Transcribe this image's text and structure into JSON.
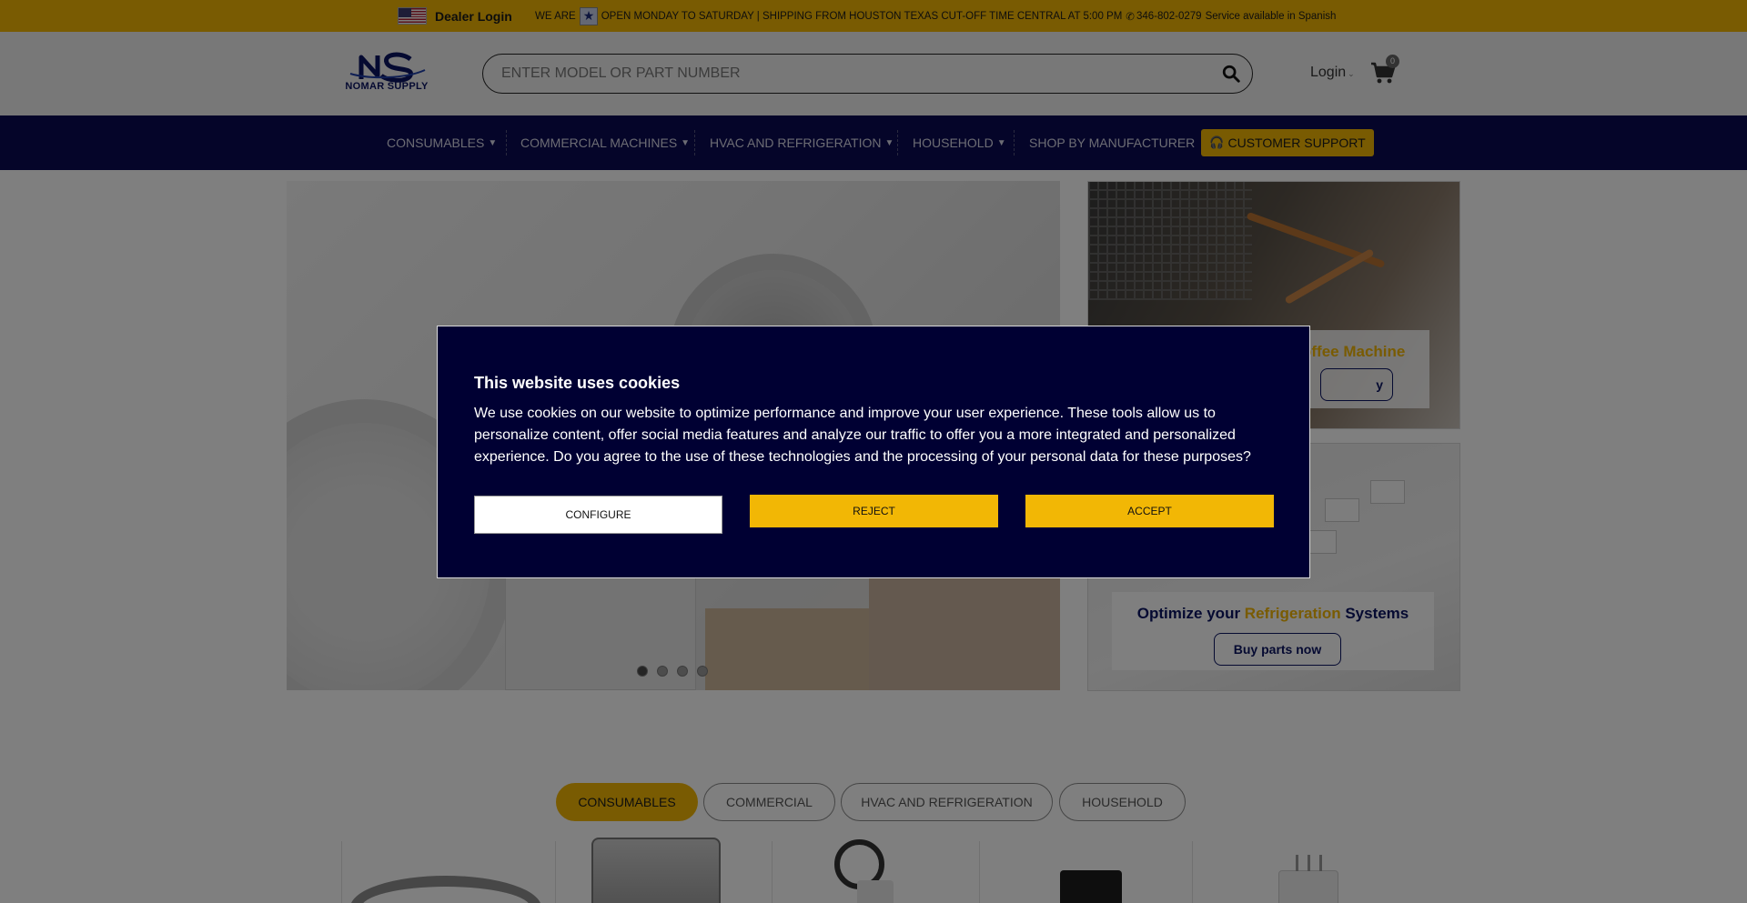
{
  "topbar": {
    "dealer_login": "Dealer Login",
    "we_are": "WE ARE",
    "hours": "OPEN MONDAY TO SATURDAY | SHIPPING FROM HOUSTON TEXAS  CUT-OFF TIME CENTRAL AT 5:00 PM",
    "phone": "346-802-0279",
    "spanish": "Service available in Spanish"
  },
  "header": {
    "logo_initials": "NS",
    "logo_text": "NOMAR SUPPLY",
    "search_placeholder": "ENTER MODEL OR PART NUMBER",
    "login_label": "Login",
    "cart_count": "0"
  },
  "nav": {
    "items": [
      {
        "label": "CONSUMABLES"
      },
      {
        "label": "COMMERCIAL MACHINES"
      },
      {
        "label": "HVAC AND REFRIGERATION"
      },
      {
        "label": "HOUSEHOLD"
      },
      {
        "label": "SHOP BY MANUFACTURER"
      }
    ],
    "support_label": "CUSTOMER SUPPORT"
  },
  "banners": {
    "top": {
      "title_fragment": "offee Machine",
      "button_fragment": "y"
    },
    "bottom": {
      "title_prefix": "Optimize your ",
      "title_accent": "Refrigeration",
      "title_suffix": " Systems",
      "button": "Buy parts now"
    }
  },
  "carousel": {
    "slide_count": 4,
    "active_index": 0
  },
  "tabs": [
    {
      "label": "CONSUMABLES",
      "active": true
    },
    {
      "label": "COMMERCIAL",
      "active": false
    },
    {
      "label": "HVAC AND REFRIGERATION",
      "active": false
    },
    {
      "label": "HOUSEHOLD",
      "active": false
    }
  ],
  "cookie": {
    "title": "This website uses cookies",
    "body": "We use cookies on our website to optimize performance and improve your user experience. These tools allow us to personalize content, offer social media features and analyze our traffic to offer you a more integrated and personalized experience. Do you agree to the use of these technologies and the processing of your personal data for these purposes?",
    "configure": "CONFIGURE",
    "reject": "REJECT",
    "accept": "ACCEPT"
  },
  "colors": {
    "accent_yellow": "#f2b705",
    "navy": "#0a0a52",
    "modal_bg": "#000033"
  },
  "icons": {
    "search": "search-icon",
    "cart": "cart-icon",
    "headset": "headset-icon",
    "phone": "phone-icon"
  }
}
